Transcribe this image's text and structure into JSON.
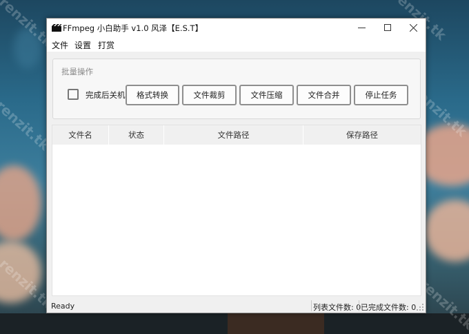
{
  "watermark": "renzit.tk",
  "window": {
    "title": "FFmpeg 小白助手 v1.0 风泽【E.S.T】",
    "icon": "film-slate-icon",
    "controls": {
      "minimize": "—",
      "maximize": "☐",
      "close": "✕"
    }
  },
  "menu": {
    "items": [
      {
        "label": "文件"
      },
      {
        "label": "设置"
      },
      {
        "label": "打赏"
      }
    ]
  },
  "batch": {
    "title": "批量操作",
    "shutdown_label": "完成后关机",
    "shutdown_checked": false,
    "buttons": [
      {
        "label": "格式转换"
      },
      {
        "label": "文件裁剪"
      },
      {
        "label": "文件压缩"
      },
      {
        "label": "文件合并"
      },
      {
        "label": "停止任务"
      }
    ]
  },
  "table": {
    "columns": [
      "文件名",
      "状态",
      "文件路径",
      "保存路径"
    ],
    "rows": []
  },
  "status": {
    "text": "Ready",
    "list_count": "列表文件数: 0",
    "done_count": "已完成文件数: 0"
  }
}
